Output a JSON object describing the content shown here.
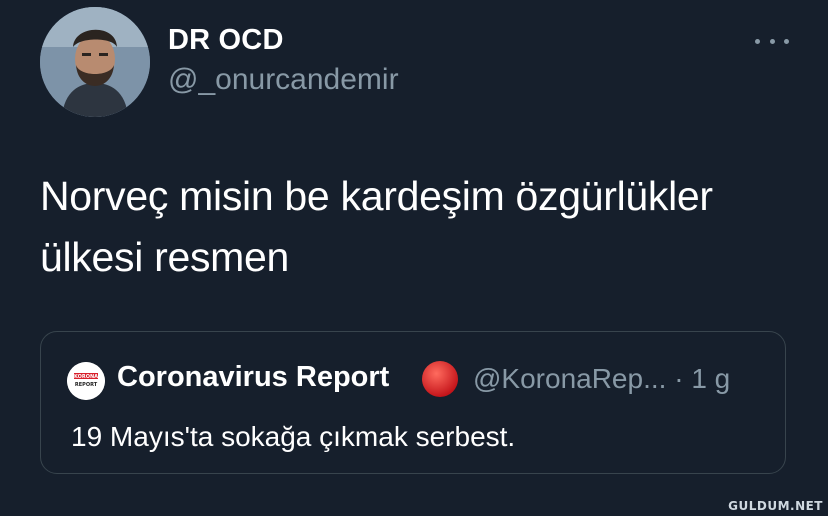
{
  "tweet": {
    "author": {
      "display_name": "DR OCD",
      "handle": "@_onurcandemir",
      "avatar_icon": "user-avatar"
    },
    "more_icon": "more-horizontal-icon",
    "text_line1": "Norveç misin be kardeşim özgürlükler",
    "text_line2": "ülkesi resmen"
  },
  "quoted_tweet": {
    "avatar_label_top": "KORONA",
    "avatar_label_bottom": "REPORT",
    "display_name": "Coronavirus Report",
    "badge_icon": "red-circle-icon",
    "handle": "@KoronaRep...",
    "separator": "·",
    "time": "1 g",
    "text": "19 Mayıs'ta sokağa çıkmak serbest."
  },
  "watermark": "GULDUM.NET",
  "colors": {
    "background": "#161f2c",
    "text_primary": "#ffffff",
    "text_secondary": "#8899a6",
    "border": "#38444d",
    "badge_red": "#e0201f"
  }
}
